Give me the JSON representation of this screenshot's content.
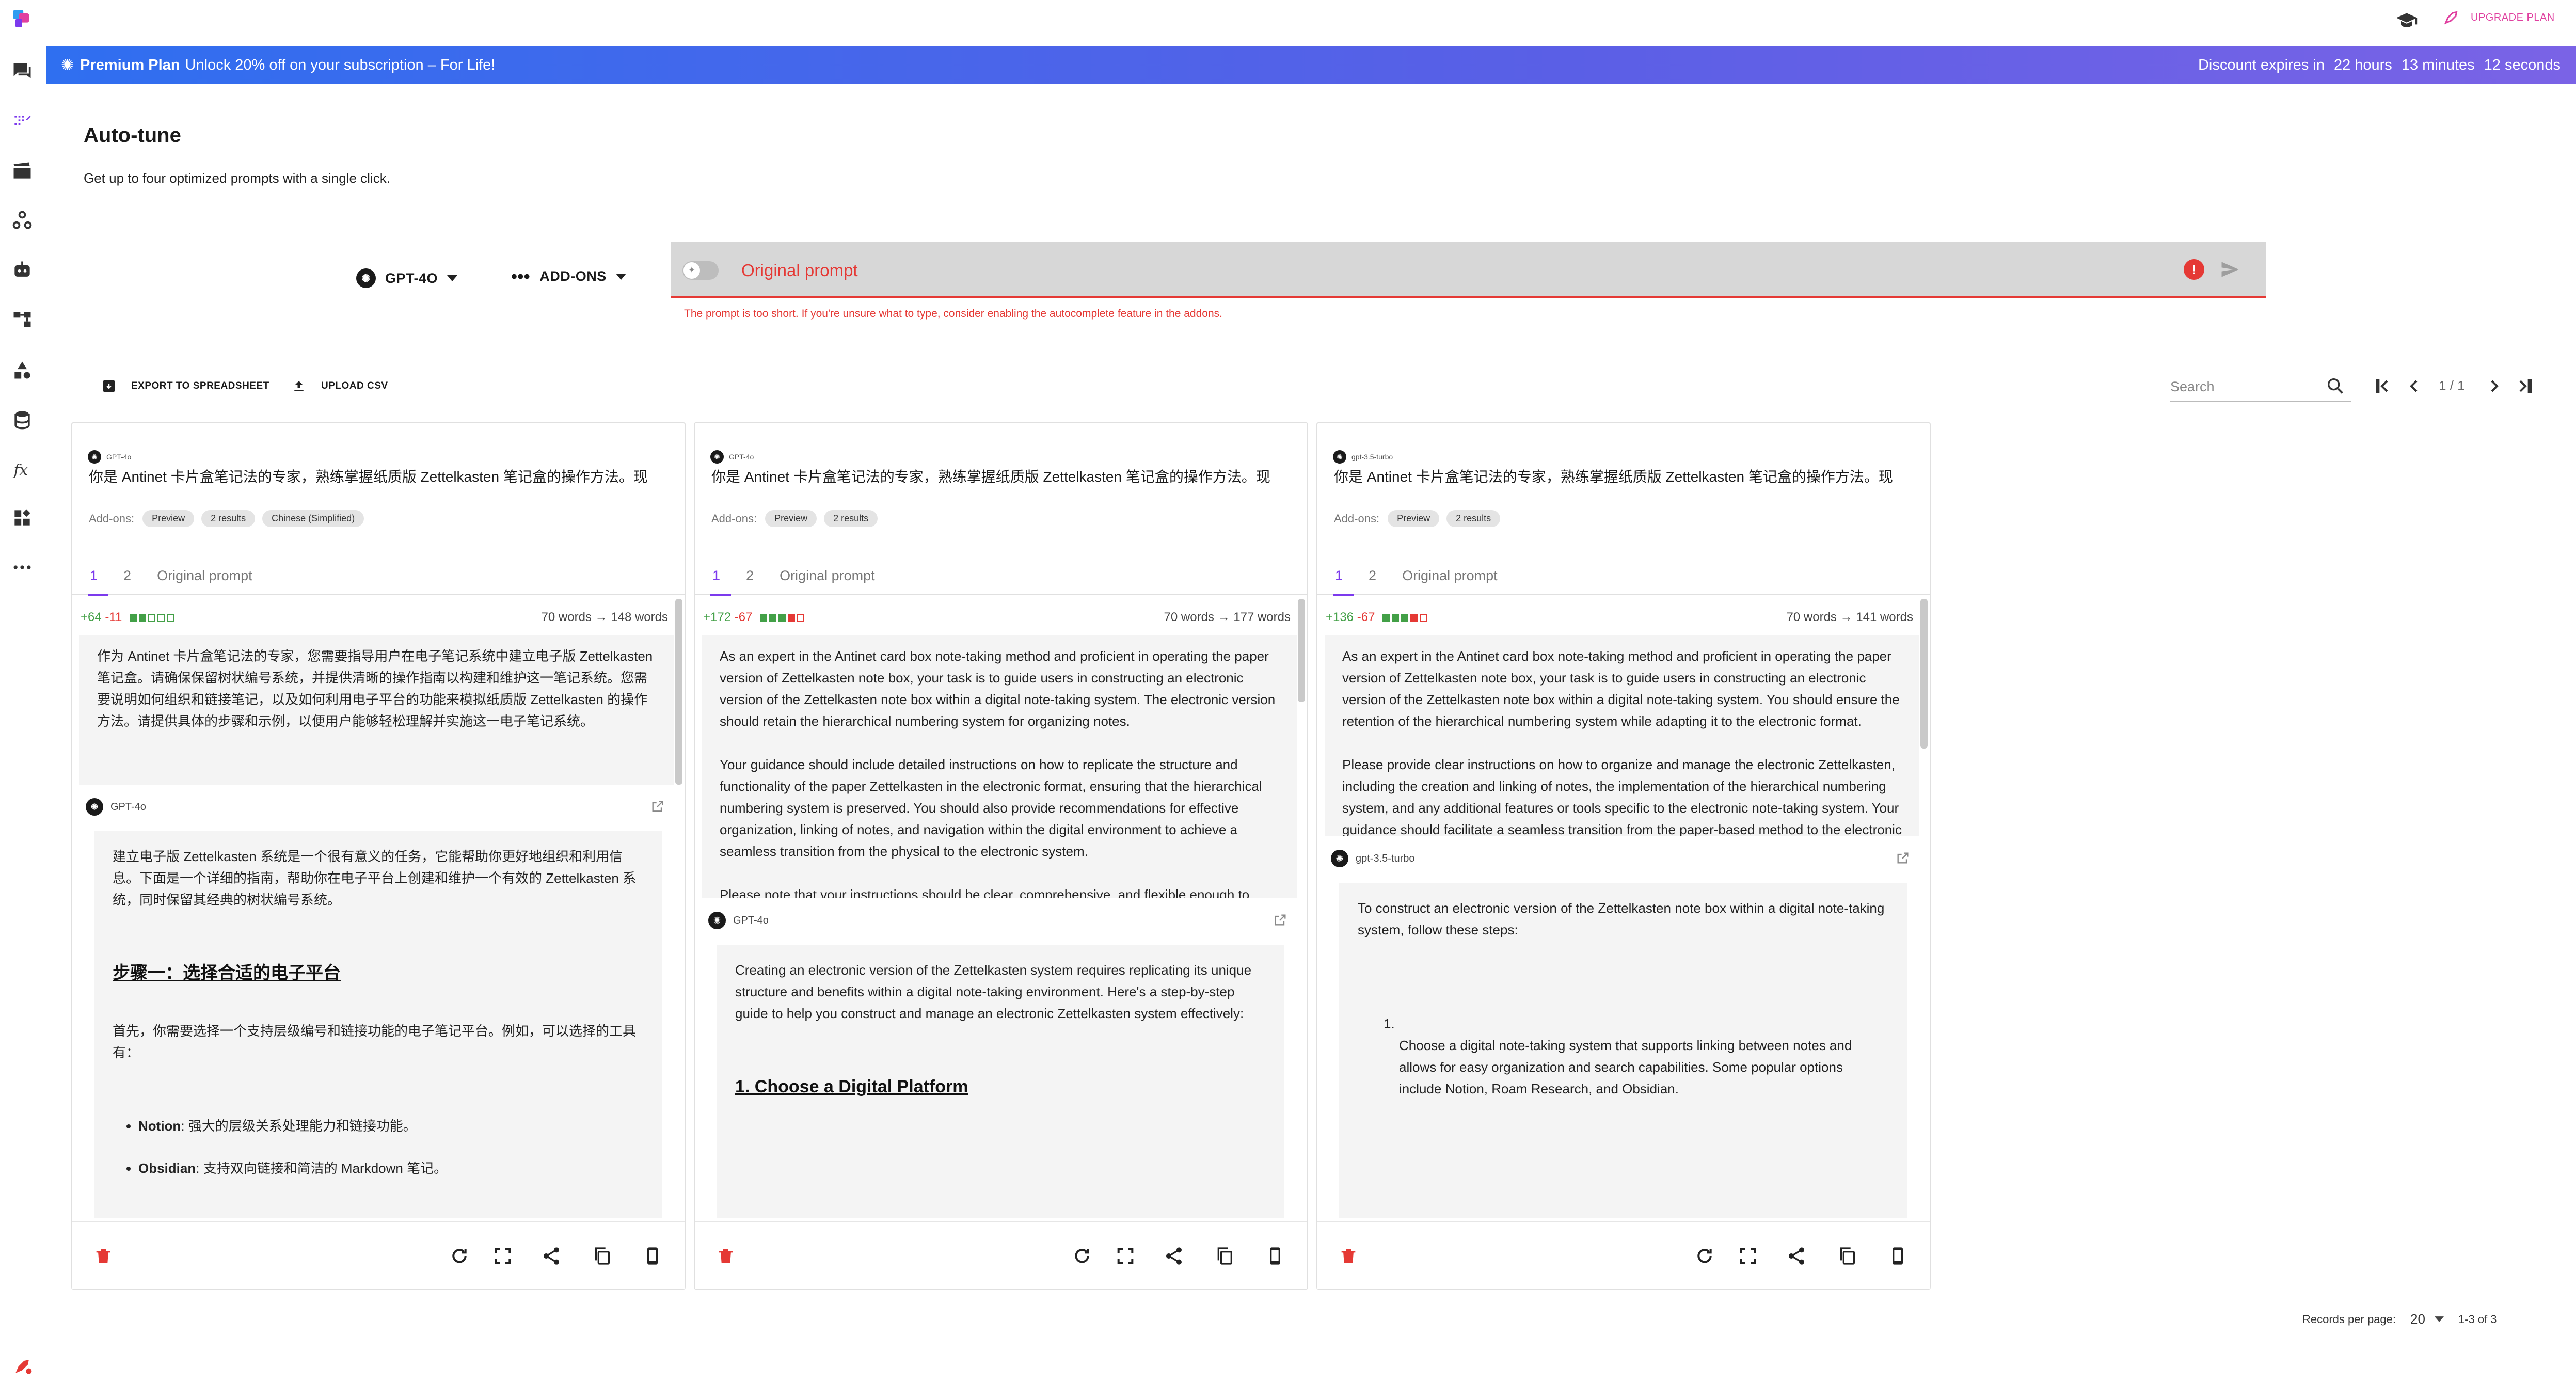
{
  "topbar": {
    "upgrade_label": "UPGRADE PLAN"
  },
  "banner": {
    "plan_label": "Premium Plan",
    "message": "Unlock 20% off on your subscription – For Life!",
    "expires_label": "Discount expires in",
    "hours": "22 hours",
    "minutes": "13 minutes",
    "seconds": "12 seconds"
  },
  "header": {
    "title": "Auto-tune",
    "subtitle": "Get up to four optimized prompts with a single click."
  },
  "controls": {
    "model_label": "GPT-4O",
    "addons_label": "ADD-ONS",
    "prompt_placeholder": "Original prompt",
    "prompt_error": "The prompt is too short. If you're unsure what to type, consider enabling the autocomplete feature in the addons."
  },
  "toolbar": {
    "export_label": "EXPORT TO SPREADSHEET",
    "upload_label": "UPLOAD CSV",
    "search_placeholder": "Search",
    "page_indicator": "1 / 1"
  },
  "cards": [
    {
      "model_small": "GPT-4o",
      "prompt": "你是 Antinet 卡片盒笔记法的专家，熟练掌握纸质版 Zettelkasten 笔记盒的操作方法。现",
      "addons_label": "Add-ons:",
      "chips": [
        "Preview",
        "2 results",
        "Chinese (Simplified)"
      ],
      "tabs": [
        "1",
        "2",
        "Original prompt"
      ],
      "plus": "+64",
      "minus": "-11",
      "words": "70 words → 148 words",
      "response": "作为 Antinet 卡片盒笔记法的专家，您需要指导用户在电子笔记系统中建立电子版 Zettelkasten 笔记盒。请确保保留树状编号系统，并提供清晰的操作指南以构建和维护这一笔记系统。您需要说明如何组织和链接笔记，以及如何利用电子平台的功能来模拟纸质版 Zettelkasten 的操作方法。请提供具体的步骤和示例，以便用户能够轻松理解并实施这一电子笔记系统。",
      "answer_model": "GPT-4o",
      "answer_p1": "建立电子版 Zettelkasten 系统是一个很有意义的任务，它能帮助你更好地组织和利用信息。下面是一个详细的指南，帮助你在电子平台上创建和维护一个有效的 Zettelkasten 系统，同时保留其经典的树状编号系统。",
      "answer_heading": "步骤一：选择合适的电子平台",
      "answer_p2": "首先，你需要选择一个支持层级编号和链接功能的电子笔记平台。例如，可以选择的工具有：",
      "answer_list": [
        {
          "name": "Notion",
          "desc": ": 强大的层级关系处理能力和链接功能。"
        },
        {
          "name": "Obsidian",
          "desc": ": 支持双向链接和简洁的 Markdown 笔记。"
        }
      ]
    },
    {
      "model_small": "GPT-4o",
      "prompt": "你是 Antinet 卡片盒笔记法的专家，熟练掌握纸质版 Zettelkasten 笔记盒的操作方法。现",
      "addons_label": "Add-ons:",
      "chips": [
        "Preview",
        "2 results"
      ],
      "tabs": [
        "1",
        "2",
        "Original prompt"
      ],
      "plus": "+172",
      "minus": "-67",
      "words": "70 words → 177 words",
      "response_paras": [
        "As an expert in the Antinet card box note-taking method and proficient in operating the paper version of Zettelkasten note box, your task is to guide users in constructing an electronic version of the Zettelkasten note box within a digital note-taking system. The electronic version should retain the hierarchical numbering system for organizing notes.",
        "Your guidance should include detailed instructions on how to replicate the structure and functionality of the paper Zettelkasten in the electronic format, ensuring that the hierarchical numbering system is preserved. You should also provide recommendations for effective organization, linking of notes, and navigation within the digital environment to achieve a seamless transition from the physical to the electronic system.",
        "Please note that your instructions should be clear, comprehensive, and flexible enough to accommodate various digital note-taking platforms and user preferences. Additionally, your guidance should aim to optimize the benefits of the Zettelkasten method within the electronic environment, fostering efficient knowledge management and retrieval."
      ],
      "answer_model": "GPT-4o",
      "answer_p1": "Creating an electronic version of the Zettelkasten system requires replicating its unique structure and benefits within a digital note-taking environment. Here's a step-by-step guide to help you construct and manage an electronic Zettelkasten system effectively:",
      "answer_heading": "1. Choose a Digital Platform"
    },
    {
      "model_small": "gpt-3.5-turbo",
      "prompt": "你是 Antinet 卡片盒笔记法的专家，熟练掌握纸质版 Zettelkasten 笔记盒的操作方法。现",
      "addons_label": "Add-ons:",
      "chips": [
        "Preview",
        "2 results"
      ],
      "tabs": [
        "1",
        "2",
        "Original prompt"
      ],
      "plus": "+136",
      "minus": "-67",
      "words": "70 words → 141 words",
      "response_paras": [
        "As an expert in the Antinet card box note-taking method and proficient in operating the paper version of Zettelkasten note box, your task is to guide users in constructing an electronic version of the Zettelkasten note box within a digital note-taking system. You should ensure the retention of the hierarchical numbering system while adapting it to the electronic format.",
        "Please provide clear instructions on how to organize and manage the electronic Zettelkasten, including the creation and linking of notes, the implementation of the hierarchical numbering system, and any additional features or tools specific to the electronic note-taking system. Your guidance should facilitate a seamless transition from the paper-based method to the electronic platform while maintaining the core principles and functionality of the Zettelkasten note box."
      ],
      "answer_model": "gpt-3.5-turbo",
      "answer_p1": "To construct an electronic version of the Zettelkasten note box within a digital note-taking system, follow these steps:",
      "answer_num": "1.",
      "answer_p2": "Choose a digital note-taking system that supports linking between notes and allows for easy organization and search capabilities. Some popular options include Notion, Roam Research, and Obsidian."
    }
  ],
  "pagination": {
    "records_label": "Records per page:",
    "records_value": "20",
    "range": "1-3 of 3"
  },
  "colors": {
    "accent": "#7c3aed",
    "error": "#e53935",
    "banner_start": "#2f6ff0",
    "banner_end": "#7a63e6",
    "upgrade": "#e040a0"
  }
}
